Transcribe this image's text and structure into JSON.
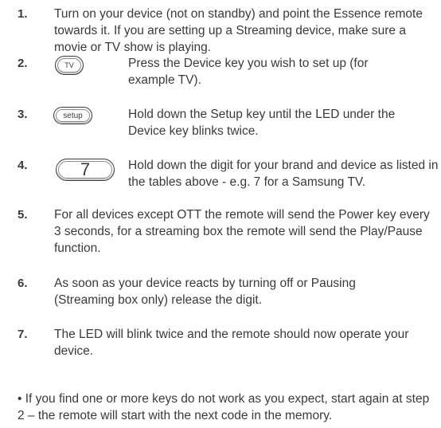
{
  "steps": [
    {
      "number": "1.",
      "text": "Turn on your device (not on standby) and point the Essence remote towards it. If you are setting up a Streaming device, make sure a movie or TV show is playing."
    },
    {
      "number": "2.",
      "key_label": "TV",
      "text": "Press the Device key you wish to set up (for example TV)."
    },
    {
      "number": "3.",
      "key_label": "setup",
      "text": "Hold down the Setup key until the LED under the Device key blinks twice."
    },
    {
      "number": "4.",
      "key_label": "7",
      "text": "Hold down the digit for your brand and device as listed in the tables above - e.g. 7  for a Samsung TV."
    },
    {
      "number": "5.",
      "text": "For all devices except OTT the remote will send the Power key every 3 seconds,  for a streaming box the remote will send the Play/Pause function."
    },
    {
      "number": "6.",
      "text": "As soon as your device reacts by turning off or Pausing (Streaming box only) release the digit."
    },
    {
      "number": "7.",
      "text": "The LED will blink twice and the remote should now operate your device."
    }
  ],
  "note": "• If you find one or more keys do not work as you expect, start again at step 2 – the remote will start with the next code in the memory."
}
